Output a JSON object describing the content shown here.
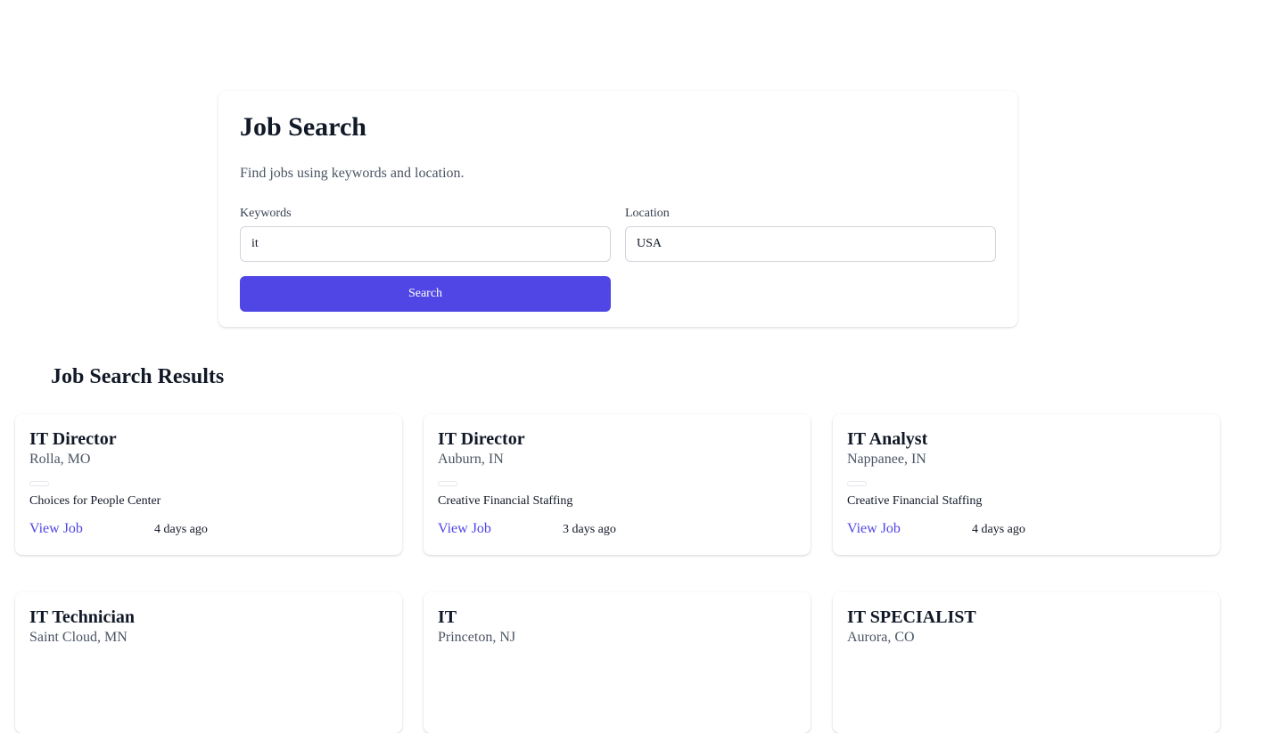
{
  "search": {
    "title": "Job Search",
    "subtitle": "Find jobs using keywords and location.",
    "keywords_label": "Keywords",
    "keywords_value": "it",
    "location_label": "Location",
    "location_value": "USA",
    "button_label": "Search"
  },
  "results": {
    "title": "Job Search Results",
    "jobs": [
      {
        "title": "IT Director",
        "location": "Rolla, MO",
        "company": "Choices for People Center",
        "link_label": "View Job",
        "posted": "4 days ago"
      },
      {
        "title": "IT Director",
        "location": "Auburn, IN",
        "company": "Creative Financial Staffing",
        "link_label": "View Job",
        "posted": "3 days ago"
      },
      {
        "title": "IT Analyst",
        "location": "Nappanee, IN",
        "company": "Creative Financial Staffing",
        "link_label": "View Job",
        "posted": "4 days ago"
      },
      {
        "title": "IT Technician",
        "location": "Saint Cloud, MN"
      },
      {
        "title": "IT",
        "location": "Princeton, NJ"
      },
      {
        "title": "IT SPECIALIST",
        "location": "Aurora, CO"
      }
    ]
  },
  "colors": {
    "accent": "#4f46e5",
    "muted_text": "#4b5563"
  }
}
